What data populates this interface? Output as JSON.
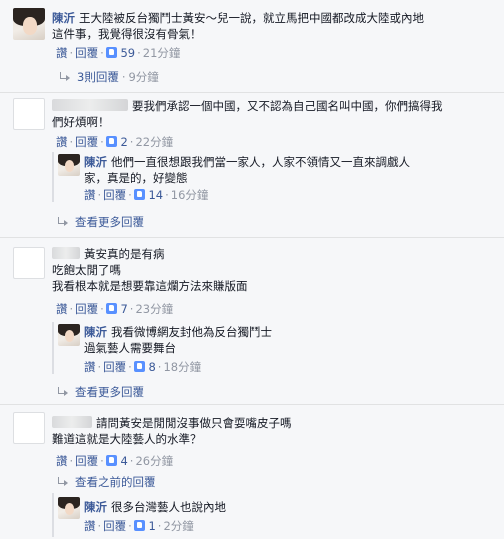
{
  "actions": {
    "like": "讚",
    "reply": "回覆",
    "dot": "·"
  },
  "c1": {
    "author": "陳沂",
    "line1": "王大陸被反台獨鬥士黃安～兒一說，就立馬把中國都改成大陸或內地",
    "line2": "這件事，我覺得很沒有骨氣！",
    "likes": "59",
    "time": "21分鐘",
    "replies_label": "3則回覆",
    "replies_time": "9分鐘"
  },
  "c2": {
    "line1": "要我們承認一個中國，又不認為自己國名叫中國，你們搞得我",
    "line2": "們好煩啊！",
    "likes": "2",
    "time": "22分鐘"
  },
  "r2": {
    "author": "陳沂",
    "line1": "他們一直很想跟我們當一家人，人家不領情又一直來調戲人",
    "line2": "家，真是的，好變態",
    "likes": "14",
    "time": "16分鐘"
  },
  "more2": "查看更多回覆",
  "c3": {
    "line1": "黃安真的是有病",
    "line2": "吃飽太閒了嗎",
    "line3": "我看根本就是想要靠這爛方法來賺版面",
    "likes": "7",
    "time": "23分鐘"
  },
  "r3": {
    "author": "陳沂",
    "line1": "我看微博網友封他為反台獨鬥士",
    "line2": "過氣藝人需要舞台",
    "likes": "8",
    "time": "18分鐘"
  },
  "more3": "查看更多回覆",
  "c4": {
    "line1": "請問黃安是閒閒沒事做只會耍嘴皮子嗎",
    "line2": "難道這就是大陸藝人的水準？",
    "likes": "4",
    "time": "26分鐘"
  },
  "prev4": "查看之前的回覆",
  "r4": {
    "author": "陳沂",
    "line1": "很多台灣藝人也說內地",
    "likes": "1",
    "time": "2分鐘"
  }
}
